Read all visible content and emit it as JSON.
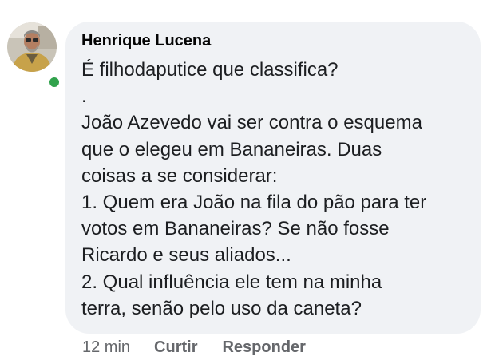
{
  "comment": {
    "author": "Henrique Lucena",
    "online_color": "#31a24c",
    "bubble_color": "#f0f2f5",
    "lines": [
      "É filhodaputice que classifica?",
      ".",
      "João Azevedo vai ser contra o esquema",
      "que o elegeu em Bananeiras. Duas",
      "coisas a se considerar:",
      "1. Quem era João na fila do pão para ter",
      "votos em Bananeiras? Se não fosse",
      "Ricardo e seus aliados...",
      "2. Qual influência ele tem na minha",
      "terra, senão pelo uso da caneta?"
    ],
    "timestamp": "12 min",
    "actions": {
      "like": "Curtir",
      "reply": "Responder"
    }
  }
}
